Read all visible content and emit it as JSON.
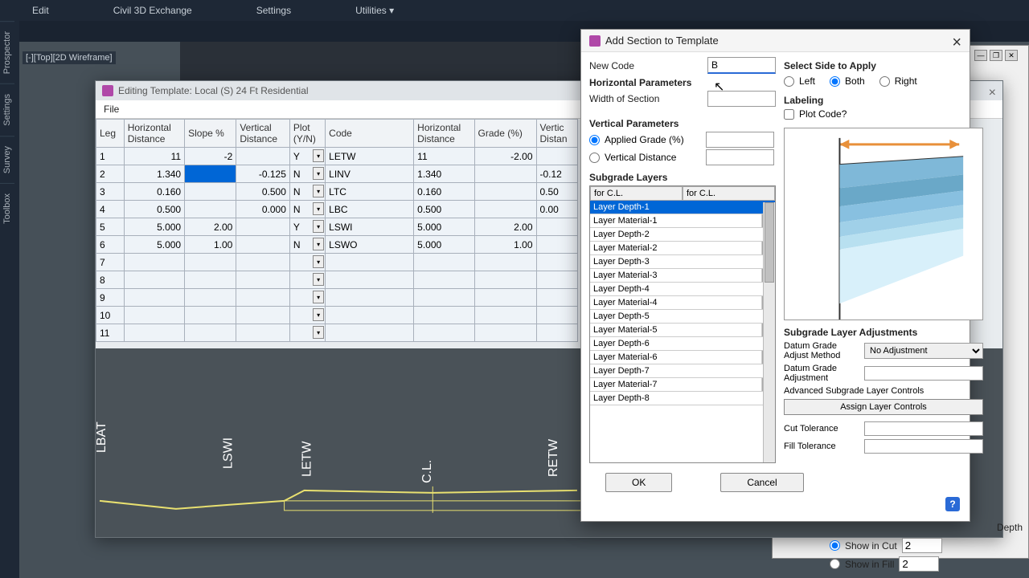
{
  "top_menu": {
    "edit": "Edit",
    "exchange": "Civil 3D Exchange",
    "settings": "Settings",
    "utilities": "Utilities ▾"
  },
  "sidebar": {
    "prospector": "Prospector",
    "settings": "Settings",
    "survey": "Survey",
    "toolbox": "Toolbox"
  },
  "viewport": "[-][Top][2D Wireframe]",
  "editor": {
    "title": "Editing Template: Local (S) 24 Ft Residential",
    "file": "File",
    "headers": {
      "leg": "Leg",
      "hdist": "Horizontal\nDistance",
      "slope": "Slope %",
      "vdist": "Vertical\nDistance",
      "plot": "Plot\n(Y/N)",
      "code": "Code",
      "hdist2": "Horizontal\nDistance",
      "grade": "Grade (%)",
      "vdist2": "Vertic\nDistan"
    },
    "rows": [
      {
        "leg": "1",
        "hd": "11",
        "sl": "-2",
        "vd": "",
        "pl": "Y",
        "cd": "LETW",
        "hd2": "11",
        "gr": "-2.00",
        "vd2": ""
      },
      {
        "leg": "2",
        "hd": "1.340",
        "sl": "",
        "vd": "-0.125",
        "pl": "N",
        "cd": "LINV",
        "hd2": "1.340",
        "gr": "",
        "vd2": "-0.12",
        "selSlope": true
      },
      {
        "leg": "3",
        "hd": "0.160",
        "sl": "",
        "vd": "0.500",
        "pl": "N",
        "cd": "LTC",
        "hd2": "0.160",
        "gr": "",
        "vd2": "0.50"
      },
      {
        "leg": "4",
        "hd": "0.500",
        "sl": "",
        "vd": "0.000",
        "pl": "N",
        "cd": "LBC",
        "hd2": "0.500",
        "gr": "",
        "vd2": "0.00"
      },
      {
        "leg": "5",
        "hd": "5.000",
        "sl": "2.00",
        "vd": "",
        "pl": "Y",
        "cd": "LSWI",
        "hd2": "5.000",
        "gr": "2.00",
        "vd2": ""
      },
      {
        "leg": "6",
        "hd": "5.000",
        "sl": "1.00",
        "vd": "",
        "pl": "N",
        "cd": "LSWO",
        "hd2": "5.000",
        "gr": "1.00",
        "vd2": ""
      },
      {
        "leg": "7"
      },
      {
        "leg": "8"
      },
      {
        "leg": "9"
      },
      {
        "leg": "10"
      },
      {
        "leg": "11"
      }
    ],
    "profile_labels": [
      "LBAT",
      "LSWI",
      "LETW",
      "C.L.",
      "RETW"
    ]
  },
  "dialog": {
    "title": "Add Section to Template",
    "new_code": "New Code",
    "new_code_val": "B",
    "hparams": "Horizontal Parameters",
    "width": "Width of Section",
    "vparams": "Vertical Parameters",
    "applied": "Applied Grade (%)",
    "vdist": "Vertical Distance",
    "sublayers": "Subgrade Layers",
    "for_cl": "for C.L.",
    "layers": [
      "Layer Depth-1",
      "Layer Material-1",
      "Layer Depth-2",
      "Layer Material-2",
      "Layer Depth-3",
      "Layer Material-3",
      "Layer Depth-4",
      "Layer Material-4",
      "Layer Depth-5",
      "Layer Material-5",
      "Layer Depth-6",
      "Layer Material-6",
      "Layer Depth-7",
      "Layer Material-7",
      "Layer Depth-8"
    ],
    "ok": "OK",
    "cancel": "Cancel",
    "side_heading": "Select Side to Apply",
    "left": "Left",
    "both": "Both",
    "right": "Right",
    "labeling": "Labeling",
    "plot_code": "Plot Code?",
    "adj_heading": "Subgrade Layer Adjustments",
    "datum_method": "Datum Grade\nAdjust Method",
    "no_adj": "No Adjustment",
    "datum_adj": "Datum Grade\nAdjustment",
    "adv": "Advanced Subgrade Layer Controls",
    "assign": "Assign Layer Controls",
    "cut_tol": "Cut Tolerance",
    "fill_tol": "Fill Tolerance"
  },
  "back": {
    "depth": "Depth",
    "show_cut": "Show in Cut",
    "cut_val": "2",
    "show_fill": "Show in Fill",
    "fill_val": "2"
  }
}
